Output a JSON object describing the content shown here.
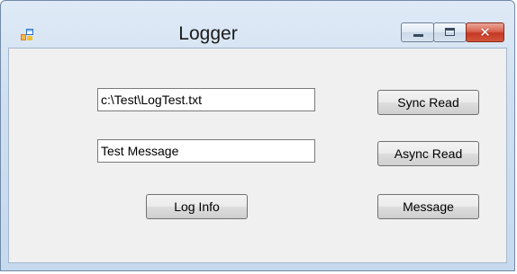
{
  "window": {
    "title": "Logger",
    "icon": "windows-forms-app-icon"
  },
  "caption_buttons": {
    "minimize_icon": "minimize-icon",
    "maximize_icon": "maximize-icon",
    "close_glyph": "✕"
  },
  "form": {
    "file_path_value": "c:\\Test\\LogTest.txt",
    "message_value": "Test Message",
    "log_info_label": "Log Info",
    "sync_read_label": "Sync Read",
    "async_read_label": "Async Read",
    "message_label": "Message"
  },
  "colors": {
    "frame": "#c6d9ee",
    "client": "#f0f0f0",
    "close": "#c33a24"
  }
}
